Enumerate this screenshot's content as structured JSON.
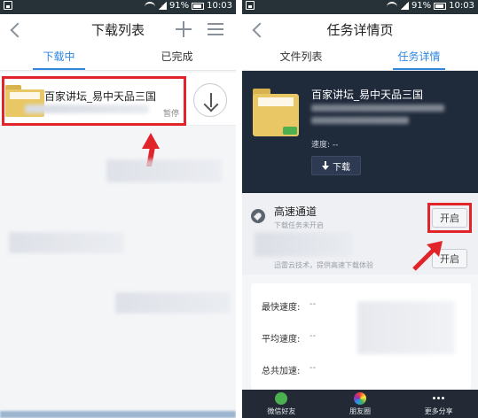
{
  "status_bar": {
    "battery": "91%",
    "time": "10:03"
  },
  "left_screen": {
    "title": "下载列表",
    "tabs": [
      {
        "label": "下载中",
        "active": true
      },
      {
        "label": "已完成",
        "active": false
      }
    ],
    "task": {
      "name": "百家讲坛_易中天品三国",
      "status": "暂停"
    }
  },
  "right_screen": {
    "title": "任务详情页",
    "tabs": [
      {
        "label": "文件列表",
        "active": false
      },
      {
        "label": "任务详情",
        "active": true
      }
    ],
    "file_name": "百家讲坛_易中天品三国",
    "speed": "速度: --",
    "download_button": "下载",
    "high_speed": {
      "title": "高速通道",
      "subtitle": "下载任务未开启",
      "open_label": "开启",
      "note": "迅雷云技术，提供高速下载体验",
      "open_label_2": "开启"
    },
    "stats": [
      {
        "label": "最快速度:",
        "value": "--"
      },
      {
        "label": "平均速度:",
        "value": "--"
      },
      {
        "label": "总共加速:",
        "value": "--"
      }
    ],
    "share": [
      {
        "label": "微信好友",
        "icon": "wechat-icon"
      },
      {
        "label": "朋友圈",
        "icon": "moments-icon"
      },
      {
        "label": "更多分享",
        "icon": "more-icon"
      }
    ]
  },
  "colors": {
    "accent": "#2e86de",
    "highlight": "#e0242a",
    "hero_bg": "#1f2a3b"
  }
}
